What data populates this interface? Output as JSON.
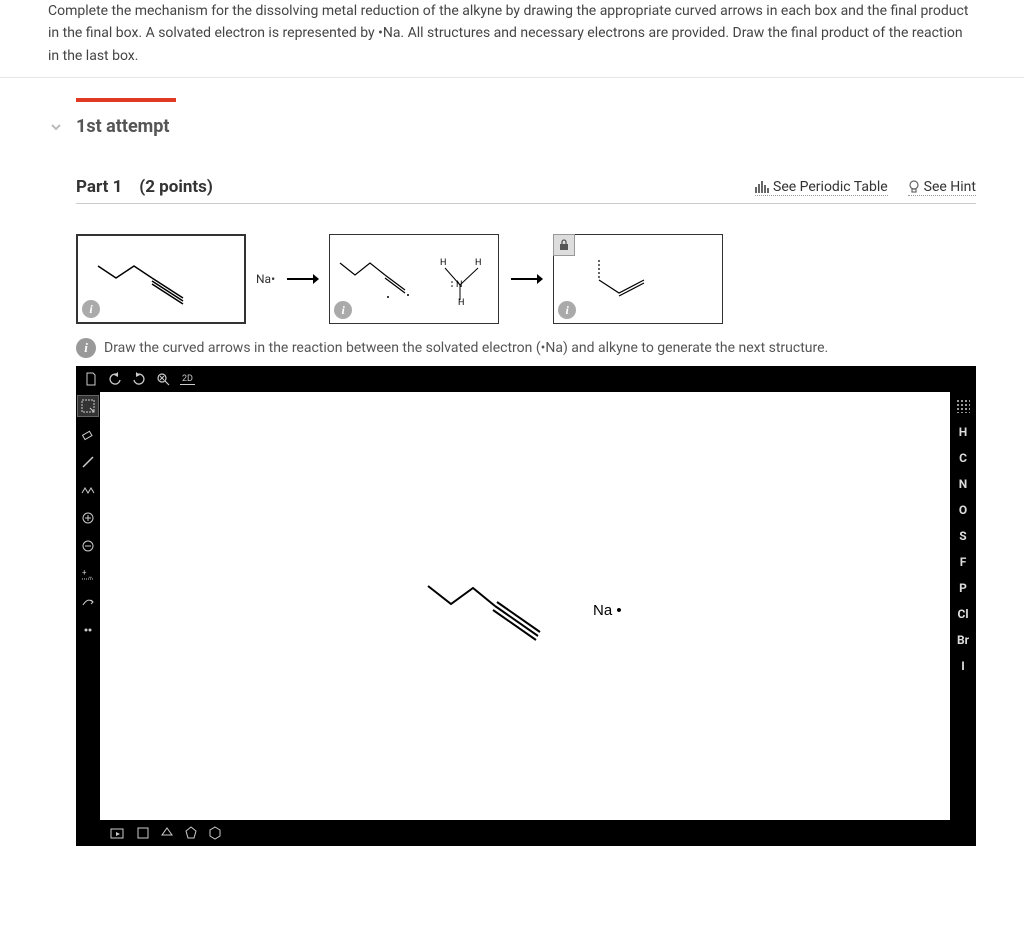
{
  "question": "Complete the mechanism for the dissolving metal reduction of the alkyne by drawing the appropriate curved arrows in each box and the final product in the final box. A solvated electron is represented by •Na. All structures and necessary electrons are provided. Draw the final product of the reaction in the last box.",
  "attempt_label": "1st attempt",
  "part": {
    "title": "Part 1",
    "points": "(2 points)",
    "periodic_link": "See Periodic Table",
    "hint_link": "See Hint"
  },
  "mech": {
    "na_label": "Na•",
    "info_char": "i"
  },
  "instruction": "Draw the curved arrows in the reaction between the solvated electron (•Na) and alkyne to generate the next structure.",
  "editor": {
    "topbar": [
      "new",
      "undo",
      "redo",
      "zoom",
      "2D"
    ],
    "topbar_2d": "2D",
    "left_tools": [
      "select",
      "erase",
      "bond",
      "chain",
      "plus",
      "minus",
      "charge",
      "arrow",
      "lonepair"
    ],
    "right_elements": [
      "H",
      "C",
      "N",
      "O",
      "S",
      "F",
      "P",
      "Cl",
      "Br",
      "I"
    ],
    "canvas_na": "Na •"
  }
}
